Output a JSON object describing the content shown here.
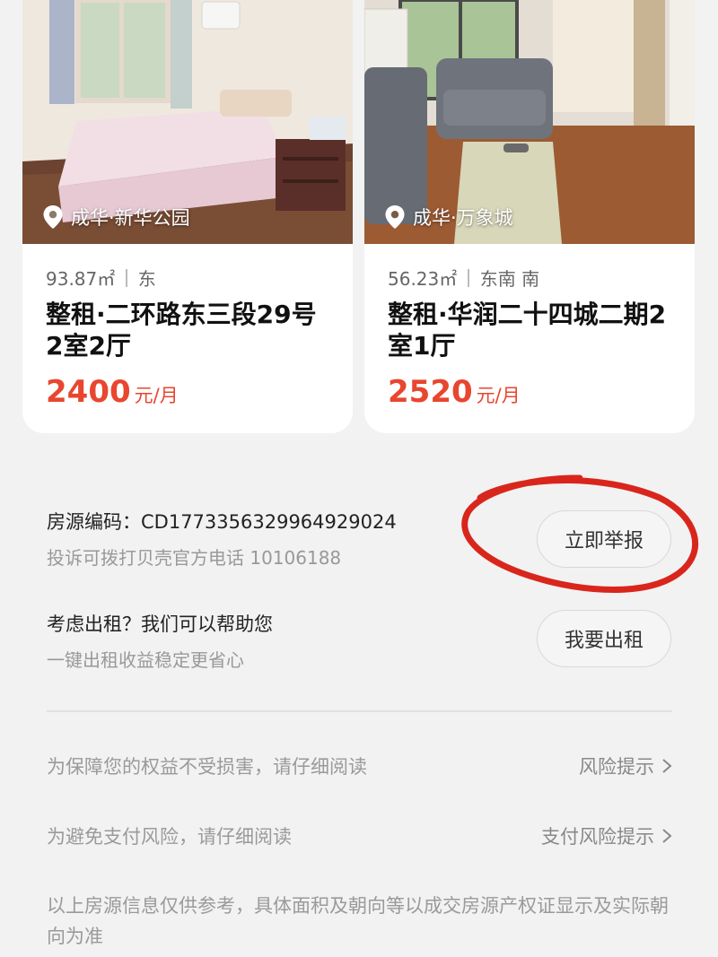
{
  "listings": [
    {
      "location": "成华·新华公园",
      "area": "93.87㎡",
      "orientation": "东",
      "title": "整租·二环路东三段29号2室2厅",
      "price": "2400",
      "price_unit": "元/月"
    },
    {
      "location": "成华·万象城",
      "area": "56.23㎡",
      "orientation": "东南 南",
      "title": "整租·华润二十四城二期2室1厅",
      "price": "2520",
      "price_unit": "元/月"
    }
  ],
  "listing_code": {
    "label": "房源编码：CD1773356329964929024",
    "complaint": "投诉可拨打贝壳官方电话 10106188",
    "button": "立即举报"
  },
  "rent_out": {
    "label": "考虑出租？我们可以帮助您",
    "sub": "一键出租收益稳定更省心",
    "button": "我要出租"
  },
  "notices": [
    {
      "text": "为保障您的权益不受损害，请仔细阅读",
      "link": "风险提示"
    },
    {
      "text": "为避免支付风险，请仔细阅读",
      "link": "支付风险提示"
    }
  ],
  "disclaimer": "以上房源信息仅供参考，具体面积及朝向等以成交房源产权证显示及实际朝向为准",
  "colors": {
    "price": "#e8462f",
    "annotation": "#d9261c",
    "background": "#f2f2f2"
  },
  "icons": [
    "location-pin-icon",
    "chevron-right-icon"
  ]
}
